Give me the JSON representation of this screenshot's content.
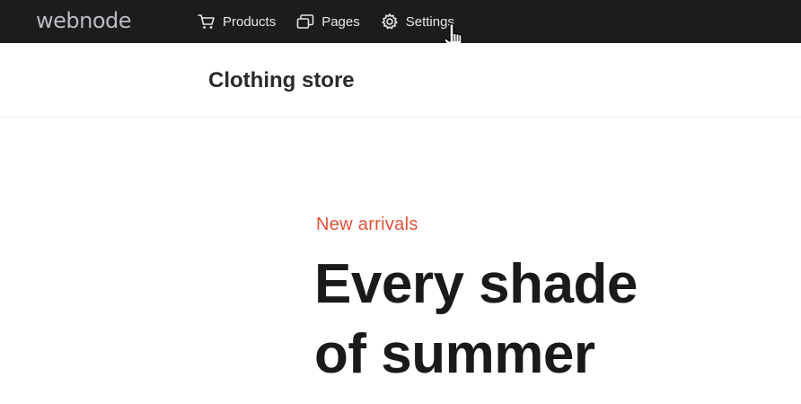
{
  "topbar": {
    "logo": "webnode",
    "nav": [
      {
        "label": "Products",
        "icon": "cart-icon"
      },
      {
        "label": "Pages",
        "icon": "pages-icon"
      },
      {
        "label": "Settings",
        "icon": "gear-icon"
      }
    ]
  },
  "store": {
    "name": "Clothing store"
  },
  "hero": {
    "kicker": "New arrivals",
    "title_line1": "Every shade",
    "title_line2": "of summer"
  },
  "colors": {
    "topbar_bg": "#1c1c1c",
    "accent": "#e0533a",
    "title_text": "#1a1a1a"
  }
}
